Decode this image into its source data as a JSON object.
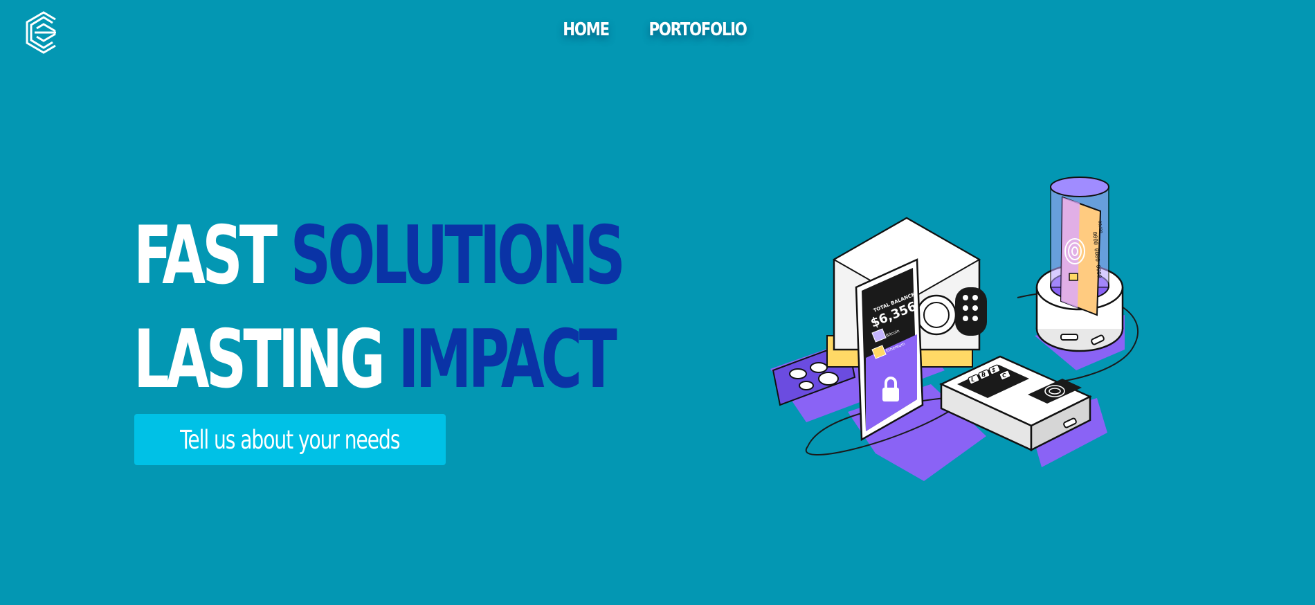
{
  "brand": {
    "logo_icon": "hexagon-e-logo-icon"
  },
  "nav": {
    "items": [
      {
        "label": "HOME"
      },
      {
        "label": "PORTOFOLIO"
      }
    ]
  },
  "hero": {
    "line1_white": "FAST",
    "line1_blue": "SOLUTIONS",
    "line2_white": "LASTING",
    "line2_blue": "IMPACT",
    "cta_label": "Tell us about your needs"
  },
  "illustration": {
    "name": "isometric-fintech-illustration",
    "phone_balance_label": "TOTAL BALANCE",
    "phone_balance": "$6,356",
    "phone_row1": "Bitcoin",
    "phone_row2": "Ethereum",
    "card_number": "0000 0000 0000",
    "card_expiry": "00/00",
    "keypad_keys": [
      "L",
      "B",
      "$",
      "C"
    ]
  },
  "colors": {
    "background": "#0397b3",
    "accent_blue": "#0a33a6",
    "cta": "#00c1e6",
    "purple": "#8a63f5"
  }
}
